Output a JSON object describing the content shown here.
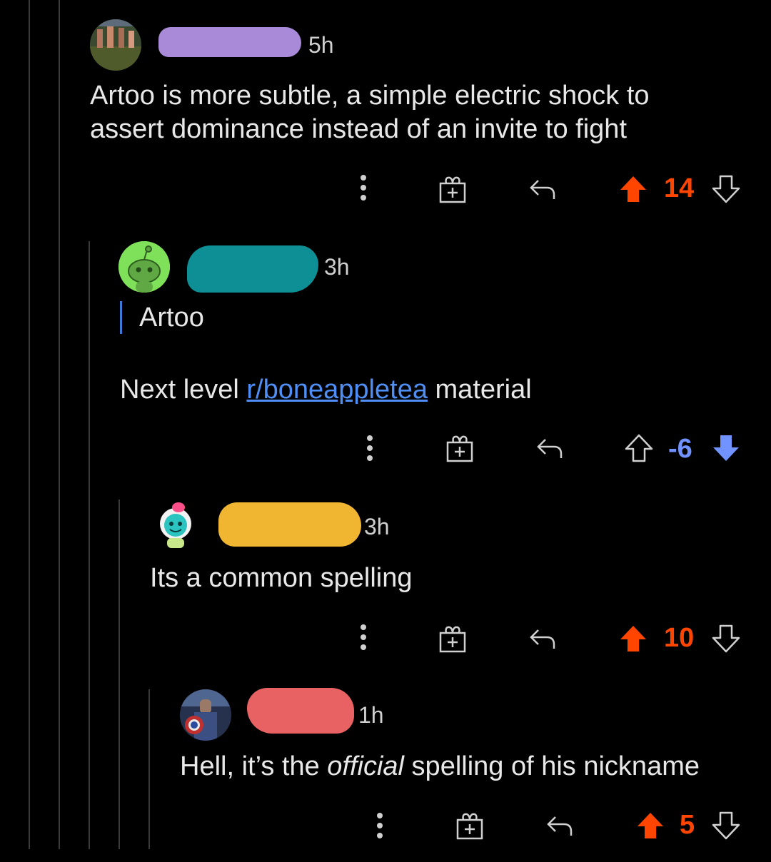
{
  "colors": {
    "upvote": "#ff4500",
    "downvote": "#7193ff",
    "thread_line": "#3a3a3a",
    "link": "#4f8ff5",
    "quote": "#3d7ad6",
    "censor_1": "#a98ad8",
    "censor_2": "#0e8f96",
    "censor_3": "#f0b631",
    "censor_4": "#e86163"
  },
  "comments": [
    {
      "time": "5h",
      "body_lines": [
        "Artoo is more subtle, a simple electric shock to",
        "assert dominance instead of an invite to fight"
      ],
      "score": "14",
      "vote_state": "up"
    },
    {
      "time": "3h",
      "quote": "Artoo",
      "body_prefix": "Next level ",
      "body_link": "r/boneappletea",
      "body_suffix": " material",
      "score": "-6",
      "vote_state": "down"
    },
    {
      "time": "3h",
      "body": "Its a common spelling",
      "score": "10",
      "vote_state": "up"
    },
    {
      "time": "1h",
      "body_prefix": "Hell, it’s the ",
      "body_italic": "official",
      "body_suffix": " spelling of his nickname",
      "score": "5",
      "vote_state": "up"
    }
  ],
  "icons": [
    "more-options-icon",
    "award-gift-icon",
    "reply-icon",
    "upvote-arrow-icon",
    "downvote-arrow-icon"
  ]
}
